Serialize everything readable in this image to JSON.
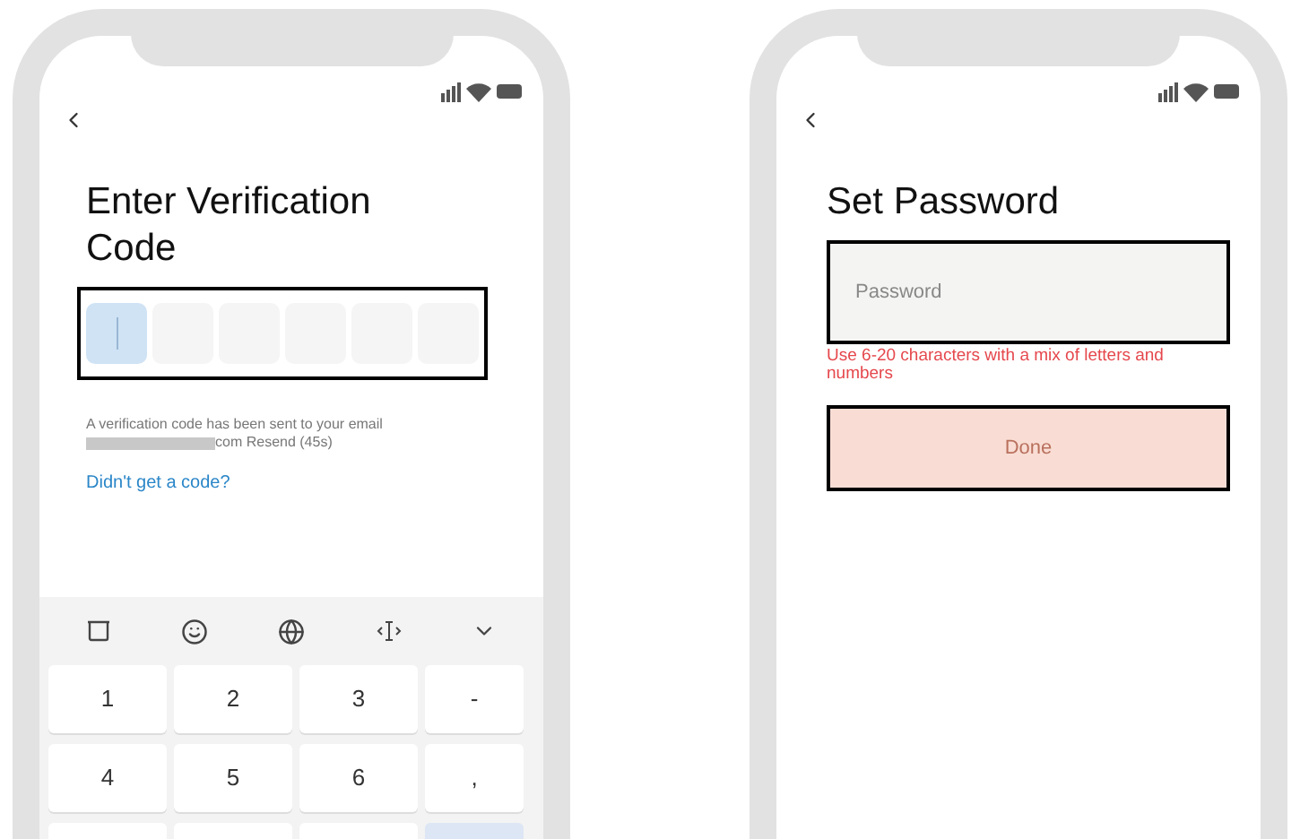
{
  "verify_screen": {
    "title": "Enter Verification Code",
    "code_boxes": [
      {
        "selected": true
      },
      {
        "selected": false
      },
      {
        "selected": false
      },
      {
        "selected": false
      },
      {
        "selected": false
      },
      {
        "selected": false
      }
    ],
    "sent_message": "A verification code has been sent to your email",
    "email_suffix": "com Resend (45s)",
    "help_link": "Didn't get a code?",
    "keyboard": {
      "keys": [
        "1",
        "2",
        "3",
        "-",
        "4",
        "5",
        "6",
        ","
      ]
    }
  },
  "password_screen": {
    "title": "Set Password",
    "password_field": {
      "placeholder": "Password"
    },
    "hint": "Use 6-20 characters with a mix of letters and numbers",
    "done_button": {
      "label": "Done",
      "disabled": true
    }
  }
}
